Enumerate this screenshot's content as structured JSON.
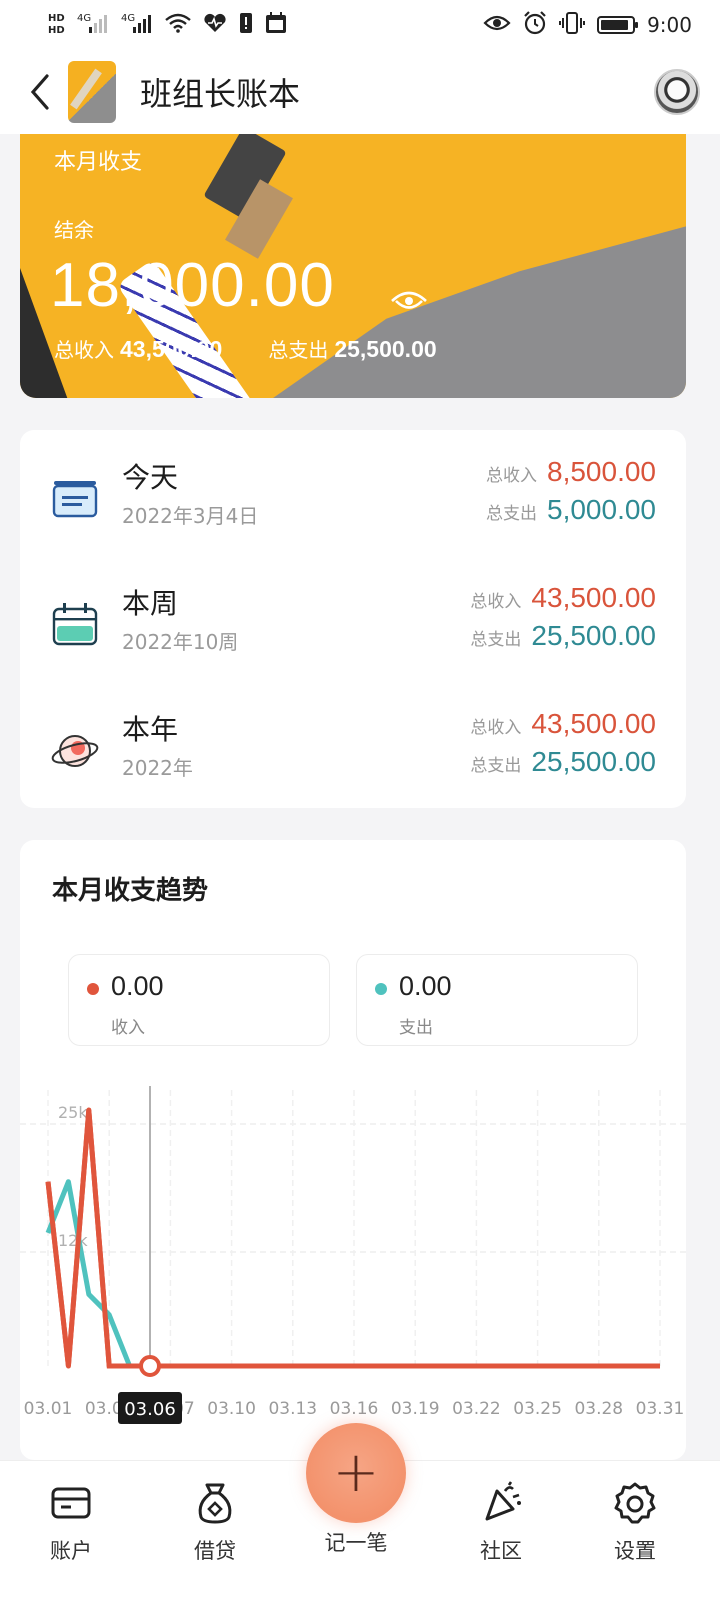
{
  "status_bar": {
    "hd1": "HD",
    "hd2": "HD",
    "signal1": "4G",
    "signal2": "4G",
    "time": "9:00"
  },
  "header": {
    "title": "班组长账本"
  },
  "banner": {
    "label": "本月收支",
    "balance_label": "结余",
    "balance": "18,000.00",
    "income_label": "总收入",
    "income": "43,500.00",
    "expense_label": "总支出",
    "expense": "25,500.00"
  },
  "summary": {
    "rows": [
      {
        "title": "今天",
        "date": "2022年3月4日",
        "income_label": "总收入",
        "income": "8,500.00",
        "expense_label": "总支出",
        "expense": "5,000.00",
        "icon": "card-icon"
      },
      {
        "title": "本周",
        "date": "2022年10周",
        "income_label": "总收入",
        "income": "43,500.00",
        "expense_label": "总支出",
        "expense": "25,500.00",
        "icon": "calendar-icon"
      },
      {
        "title": "本年",
        "date": "2022年",
        "income_label": "总收入",
        "income": "43,500.00",
        "expense_label": "总支出",
        "expense": "25,500.00",
        "icon": "planet-icon"
      }
    ]
  },
  "trend": {
    "title": "本月收支趋势",
    "legend": [
      {
        "value": "0.00",
        "label": "收入",
        "color": "#e0553c"
      },
      {
        "value": "0.00",
        "label": "支出",
        "color": "#4fc2be"
      }
    ],
    "tooltip": "03.06"
  },
  "chart_data": {
    "type": "line",
    "x": [
      "03.01",
      "03.02",
      "03.03",
      "03.04",
      "03.05",
      "03.06"
    ],
    "x_ticks": [
      "03.01",
      "03.04",
      "03.07",
      "03.10",
      "03.13",
      "03.16",
      "03.19",
      "03.22",
      "03.25",
      "03.28",
      "03.31"
    ],
    "y_ticks": [
      "25k",
      "12k"
    ],
    "ylim": [
      0,
      25000
    ],
    "series": [
      {
        "name": "收入",
        "color": "#e0553c",
        "values": [
          18000,
          0,
          25000,
          0,
          0,
          0
        ]
      },
      {
        "name": "支出",
        "color": "#4fc2be",
        "values": [
          13000,
          18000,
          7000,
          5000,
          0,
          0
        ]
      }
    ],
    "flat_to": "03.31",
    "grid": true
  },
  "bottom_nav": {
    "items": [
      {
        "label": "账户",
        "icon": "wallet-icon"
      },
      {
        "label": "借贷",
        "icon": "money-bag-icon"
      },
      {
        "label": "记一笔",
        "icon": "plus-icon"
      },
      {
        "label": "社区",
        "icon": "party-icon"
      },
      {
        "label": "设置",
        "icon": "gear-icon"
      }
    ]
  }
}
